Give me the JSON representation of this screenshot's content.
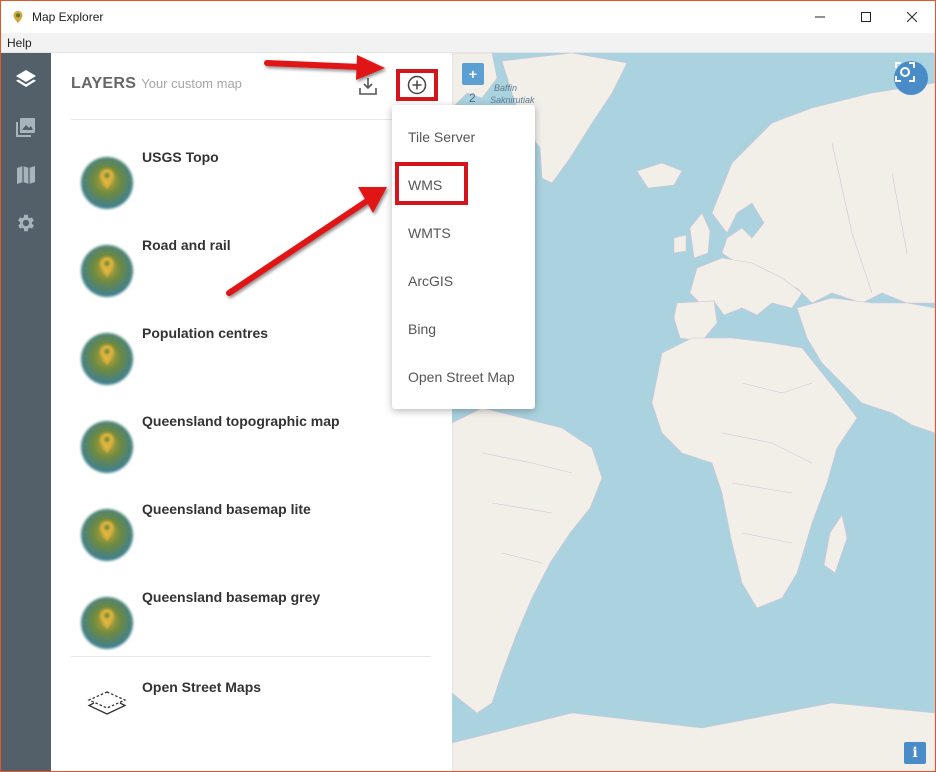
{
  "window": {
    "title": "Map Explorer",
    "controls": [
      "minimize",
      "maximize",
      "close"
    ]
  },
  "menu": {
    "items": [
      "Help"
    ]
  },
  "rail": {
    "items": [
      {
        "name": "layers",
        "icon": "layers-icon",
        "active": true
      },
      {
        "name": "gallery",
        "icon": "image-icon",
        "active": false
      },
      {
        "name": "map",
        "icon": "map-icon",
        "active": false
      },
      {
        "name": "settings",
        "icon": "gear-icon",
        "active": false
      }
    ]
  },
  "panel": {
    "title": "LAYERS",
    "subtitle": "Your custom map",
    "layers": [
      {
        "name": "USGS Topo"
      },
      {
        "name": "Road and rail"
      },
      {
        "name": "Population centres"
      },
      {
        "name": "Queensland topographic map"
      },
      {
        "name": "Queensland basemap lite"
      },
      {
        "name": "Queensland basemap grey"
      }
    ],
    "extra_layer": {
      "name": "Open Street Maps"
    }
  },
  "dropdown": {
    "items": [
      "Tile Server",
      "WMS",
      "WMTS",
      "ArcGIS",
      "Bing",
      "Open Street Map"
    ],
    "highlighted": "WMS"
  },
  "map": {
    "zoom_in_label": "+",
    "zoom_level": "2",
    "labels": {
      "baffin": "Baffin",
      "saknirutiak": "Saknirutiak"
    },
    "info_label": "i"
  },
  "colors": {
    "rail": "#53606a",
    "accent_blue": "#4a8cc7",
    "highlight_red": "#d4161c",
    "water": "#aad3df",
    "land": "#f2efe9"
  }
}
